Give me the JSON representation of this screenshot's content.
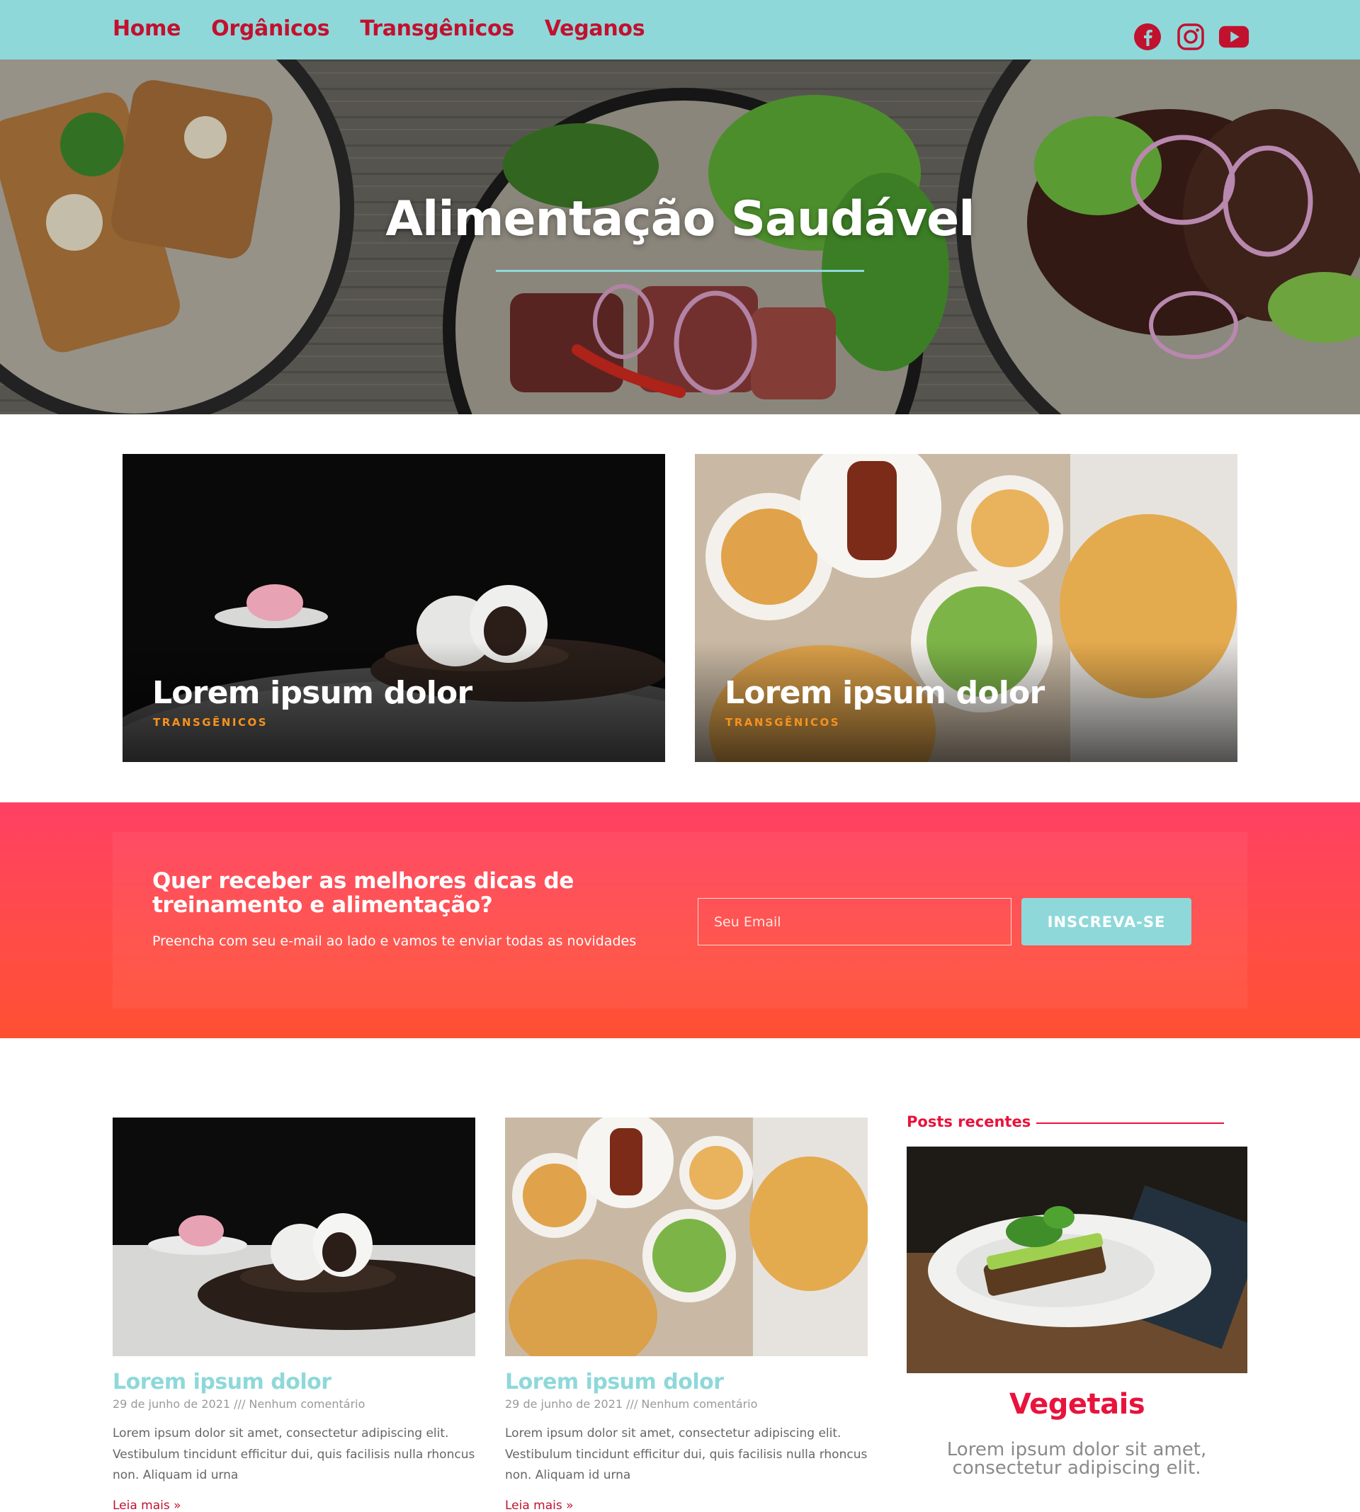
{
  "nav": {
    "items": [
      {
        "label": "Home"
      },
      {
        "label": "Orgânicos"
      },
      {
        "label": "Transgênicos"
      },
      {
        "label": "Veganos"
      }
    ],
    "socials": [
      "facebook-icon",
      "instagram-icon",
      "youtube-icon"
    ]
  },
  "hero": {
    "title": "Alimentação Saudável"
  },
  "featured": [
    {
      "title": "Lorem ipsum dolor",
      "tag": "TRANSGÊNICOS"
    },
    {
      "title": "Lorem ipsum dolor",
      "tag": "TRANSGÊNICOS"
    }
  ],
  "newsletter": {
    "title": "Quer receber as melhores dicas de treinamento e alimentação?",
    "text": "Preencha com seu e-mail ao lado e vamos te enviar todas as novidades",
    "email_placeholder": "Seu Email",
    "button_label": "INSCREVA-SE"
  },
  "posts": [
    {
      "title": "Lorem ipsum dolor",
      "meta": "29 de junho de 2021 /// Nenhum comentário",
      "excerpt": "Lorem ipsum dolor sit amet, consectetur adipiscing elit. Vestibulum tincidunt efficitur dui, quis facilisis nulla rhoncus non. Aliquam id urna",
      "more": "Leia mais »"
    },
    {
      "title": "Lorem ipsum dolor",
      "meta": "29 de junho de 2021 /// Nenhum comentário",
      "excerpt": "Lorem ipsum dolor sit amet, consectetur adipiscing elit. Vestibulum tincidunt efficitur dui, quis facilisis nulla rhoncus non. Aliquam id urna",
      "more": "Leia mais »"
    }
  ],
  "sidebar": {
    "heading": "Posts recentes",
    "post_title": "Vegetais",
    "post_text": "Lorem ipsum dolor sit amet, consectetur adipiscing elit."
  },
  "colors": {
    "header_bg": "#8fd8da",
    "nav_text": "#c2112f",
    "accent_red": "#e8133c",
    "tag_orange": "#f6921e",
    "newsletter_top": "#ff4063",
    "newsletter_bottom": "#ff5032"
  }
}
